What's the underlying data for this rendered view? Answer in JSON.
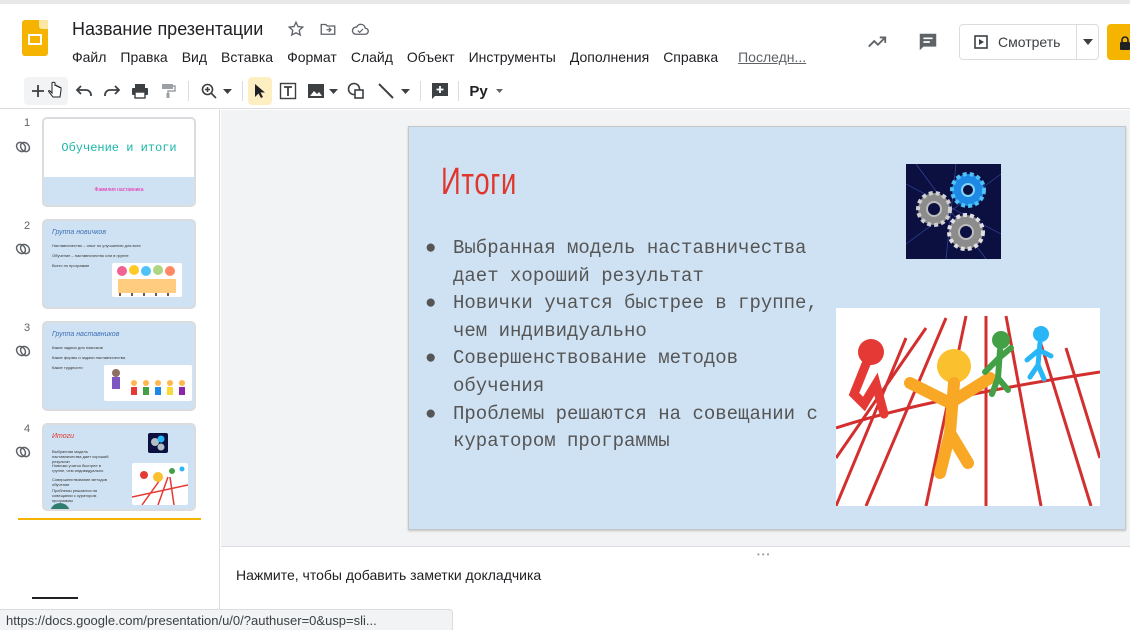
{
  "header": {
    "title": "Название презентации",
    "menu": [
      "Файл",
      "Правка",
      "Вид",
      "Вставка",
      "Формат",
      "Слайд",
      "Объект",
      "Инструменты",
      "Дополнения",
      "Справка"
    ],
    "last_edit": "Последн...",
    "present_label": "Смотреть"
  },
  "toolbar": {
    "input_tools_label": "Ру"
  },
  "filmstrip": {
    "slides": [
      {
        "number": "1",
        "title": "Обучение и итоги",
        "subtitle": "Фамилия наставника"
      },
      {
        "number": "2",
        "title": "Группа новичков",
        "lines": [
          "Наставничество – опыт по улучшению для всех",
          "Обучение – наставничество или в группе",
          "Всего по программе"
        ]
      },
      {
        "number": "3",
        "title": "Группа наставников",
        "lines": [
          "Какие задачи для новичков",
          "Какие формы и задачи наставничества",
          "Какие трудности"
        ]
      },
      {
        "number": "4",
        "title": "Итоги",
        "lines": [
          "Выбранная модель наставничества дает хороший результат",
          "Новички учатся быстрее в группе, чем индивидуально",
          "Совершенствование методов обучения",
          "Проблемы решаются на совещании с куратором программы"
        ]
      }
    ]
  },
  "slide": {
    "title": "Итоги",
    "bullets": [
      "Выбранная модель наставничества дает хороший результат",
      "Новички учатся быстрее в группе, чем индивидуально",
      "Совершенствование методов обучения",
      "Проблемы решаются на совещании с куратором программы"
    ]
  },
  "notes": {
    "placeholder": "Нажмите, чтобы добавить заметки докладчика"
  },
  "status_bar": {
    "url": "https://docs.google.com/presentation/u/0/?authuser=0&usp=sli..."
  },
  "colors": {
    "accent": "#f4b400",
    "slide_bg": "#cfe2f3",
    "title_red": "#e0372c"
  }
}
